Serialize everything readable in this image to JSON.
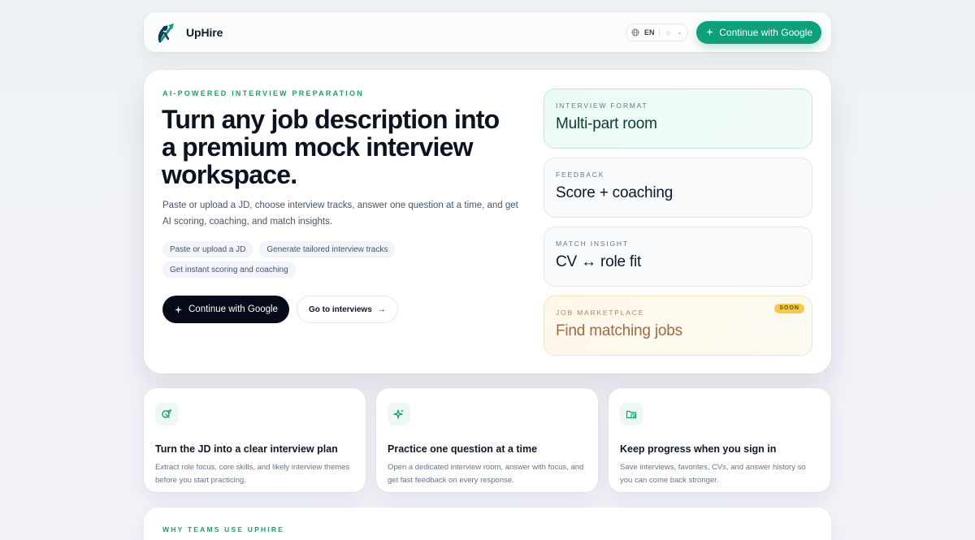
{
  "brand": {
    "name": "UpHire"
  },
  "nav": {
    "language": "EN",
    "theme_icon": "sun-icon",
    "cta_label": "Continue with Google"
  },
  "hero": {
    "eyebrow": "AI-POWERED INTERVIEW PREPARATION",
    "title": "Turn any job description into a premium mock interview workspace.",
    "subtitle": "Paste or upload a JD, choose interview tracks, answer one question at a time, and get AI scoring, coaching, and match insights.",
    "chips": [
      "Paste or upload a JD",
      "Generate tailored interview tracks",
      "Get instant scoring and coaching"
    ],
    "primary_cta": "Continue with Google",
    "secondary_cta": "Go to interviews"
  },
  "tiles": [
    {
      "label": "INTERVIEW FORMAT",
      "value": "Multi-part room"
    },
    {
      "label": "FEEDBACK",
      "value": "Score + coaching"
    },
    {
      "label": "MATCH INSIGHT",
      "value": "CV ↔ role fit"
    },
    {
      "label": "JOB MARKETPLACE",
      "value": "Find matching jobs",
      "badge": "SOON"
    }
  ],
  "cards": [
    {
      "icon": "plan-icon",
      "title": "Turn the JD into a clear interview plan",
      "desc": "Extract role focus, core skills, and likely interview themes before you start practicing."
    },
    {
      "icon": "sparkle-icon",
      "title": "Practice one question at a time",
      "desc": "Open a dedicated interview room, answer with focus, and get fast feedback on every response."
    },
    {
      "icon": "folder-clock-icon",
      "title": "Keep progress when you sign in",
      "desc": "Save interviews, favorites, CVs, and answer history so you can come back stronger."
    }
  ],
  "why": {
    "label": "WHY TEAMS USE UPHIRE"
  },
  "colors": {
    "accent": "#0e9f7b",
    "dark": "#060b1a",
    "eyebrow": "#1c9c7a",
    "soon": "#f6c94b"
  }
}
